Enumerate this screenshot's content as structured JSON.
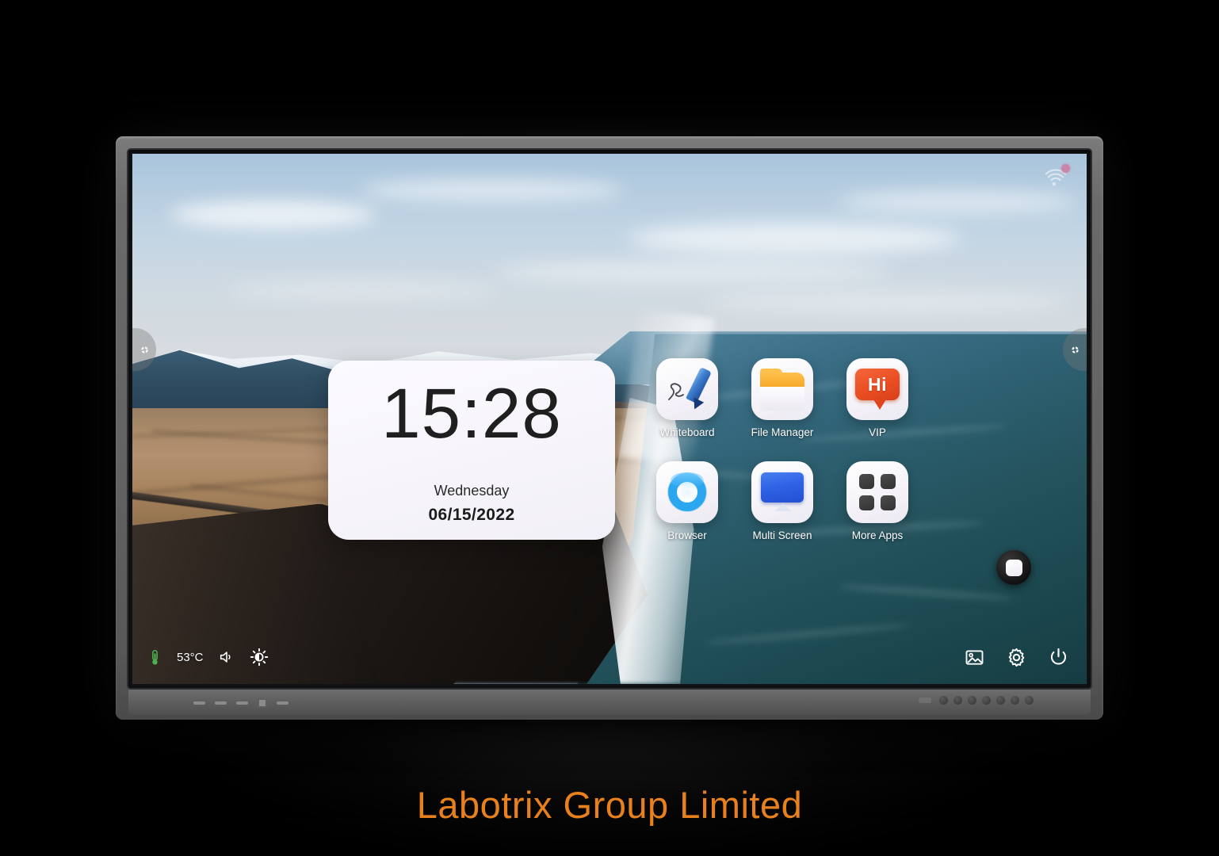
{
  "device": {
    "type": "interactive-flat-panel-display",
    "bezel_color": "#636363"
  },
  "screen": {
    "wallpaper_description": "Aerial coastline with snow-capped mountains, tan plains, black sand beach and teal ocean",
    "colors": {
      "sky": "#b6cde0",
      "mountain": "#2f4d62",
      "plain": "#a8855f",
      "beach": "#191513",
      "ocean": "#2d6071",
      "accent_orange": "#e8811c"
    }
  },
  "status_bar": {
    "wifi_icon": "wifi-icon",
    "wifi_badge_color": "#e0527d"
  },
  "side_handles": {
    "left_icon": "side-menu-handle-icon",
    "right_icon": "side-menu-handle-icon"
  },
  "clock_widget": {
    "time": "15:28",
    "weekday": "Wednesday",
    "date": "06/15/2022"
  },
  "apps": [
    {
      "label": "Whiteboard",
      "icon": "whiteboard-pen-icon"
    },
    {
      "label": "File Manager",
      "icon": "folder-icon"
    },
    {
      "label": "VIP",
      "icon": "speech-bubble-hi-icon",
      "badge_text": "Hi"
    },
    {
      "label": "Browser",
      "icon": "browser-ring-icon"
    },
    {
      "label": "Multi Screen",
      "icon": "monitor-icon"
    },
    {
      "label": "More Apps",
      "icon": "grid-apps-icon"
    }
  ],
  "floating_button": {
    "name": "home-floating-button",
    "icon": "rounded-square-icon"
  },
  "taskbar_left": {
    "temperature": "53°C",
    "thermometer_icon": "thermometer-icon",
    "thermometer_color": "#4caf50",
    "volume_icon": "volume-icon",
    "brightness_icon": "brightness-icon"
  },
  "taskbar_right": {
    "gallery_icon": "image-gallery-icon",
    "settings_icon": "gear-icon",
    "power_icon": "power-icon"
  },
  "caption": {
    "text": "Labotrix Group Limited",
    "color": "#e8811c"
  }
}
